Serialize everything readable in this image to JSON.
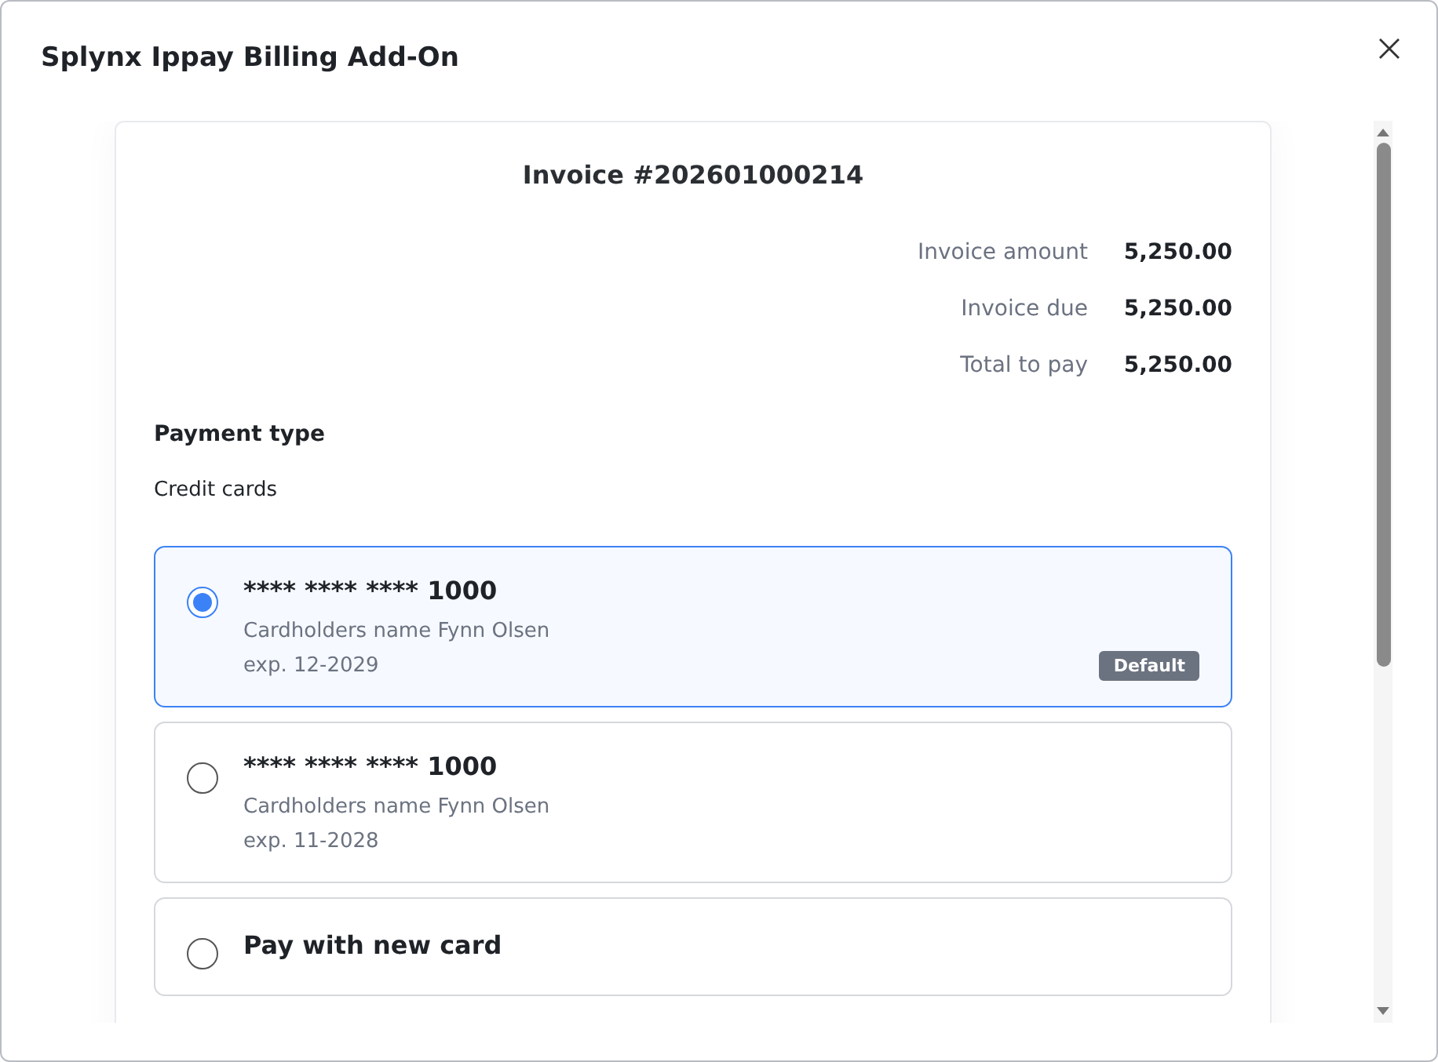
{
  "dialog": {
    "title": "Splynx Ippay Billing Add-On"
  },
  "invoice": {
    "title": "Invoice #202601000214",
    "summary": [
      {
        "label": "Invoice amount",
        "value": "5,250.00"
      },
      {
        "label": "Invoice due",
        "value": "5,250.00"
      },
      {
        "label": "Total to pay",
        "value": "5,250.00"
      }
    ]
  },
  "payment": {
    "heading": "Payment type",
    "subheading": "Credit cards",
    "options": [
      {
        "kind": "card",
        "number": "**** **** **** 1000",
        "holder": "Cardholders name Fynn Olsen",
        "expiry": "exp. 12-2029",
        "badge": "Default",
        "selected": true
      },
      {
        "kind": "card",
        "number": "**** **** **** 1000",
        "holder": "Cardholders name Fynn Olsen",
        "expiry": "exp. 11-2028",
        "selected": false
      },
      {
        "kind": "new",
        "label": "Pay with new card",
        "selected": false
      }
    ]
  }
}
